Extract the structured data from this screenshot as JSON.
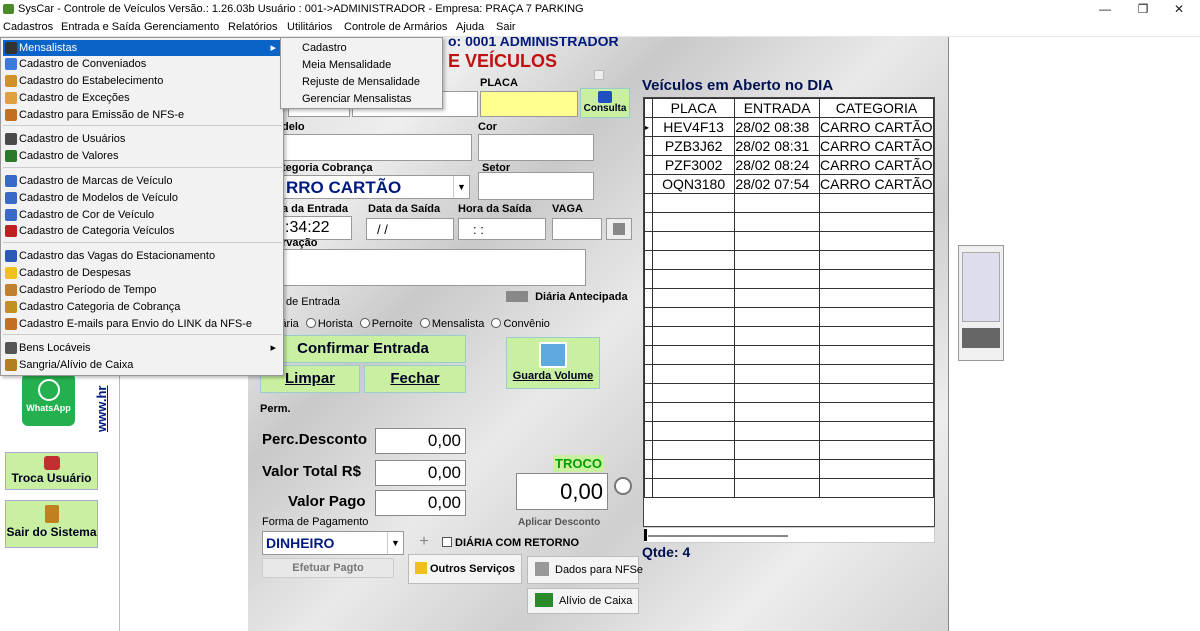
{
  "window": {
    "title": "SysCar - Controle de Veículos Versão.: 1.26.03b    Usuário : 001->ADMINISTRADOR - Empresa: PRAÇA 7 PARKING",
    "controls": {
      "minimize": "—",
      "maximize": "❐",
      "close": "✕"
    }
  },
  "menubar": [
    "Cadastros",
    "Entrada e Saída",
    "Gerenciamento",
    "Relatórios",
    "Utilitários",
    "Controle de Armários",
    "Ajuda",
    "Sair"
  ],
  "dropdown": {
    "items": [
      {
        "label": "Mensalistas",
        "accel": "M",
        "submenu": true,
        "icon": "card-icon",
        "color": "#333333"
      },
      {
        "label": "Cadastro de Conveniados",
        "accel": "C",
        "icon": "book-icon",
        "color": "#3a7ad8"
      },
      {
        "label": "Cadastro do Estabelecimento",
        "accel": "E",
        "icon": "building-icon",
        "color": "#d0902a"
      },
      {
        "label": "Cadastro de Exceções",
        "accel": "x",
        "icon": "pencil-icon",
        "color": "#e0a040"
      },
      {
        "label": "Cadastro para Emissão de NFS-e",
        "icon": "document-icon",
        "color": "#c07020"
      },
      {
        "label": "Cadastro de Usuários",
        "accel": "U",
        "icon": "users-icon",
        "color": "#4a4a4a"
      },
      {
        "label": "Cadastro de Valores",
        "accel": "V",
        "icon": "money-icon",
        "color": "#2a7a2a"
      },
      {
        "label": "Cadastro de Marcas de Veículo",
        "icon": "car-icon",
        "color": "#3a6ac8"
      },
      {
        "label": "Cadastro de Modelos de Veículo",
        "icon": "car-icon",
        "color": "#3a6ac8"
      },
      {
        "label": "Cadastro de Cor de Veículo",
        "icon": "car-icon",
        "color": "#3a6ac8"
      },
      {
        "label": "Cadastro de Categoria Veículos",
        "accel": "t",
        "icon": "car-red-icon",
        "color": "#c02020"
      },
      {
        "label": "Cadastro das Vagas do Estacionamento",
        "icon": "parking-icon",
        "color": "#2a5ab8"
      },
      {
        "label": "Cadastro de Despesas",
        "icon": "plus-icon",
        "color": "#f0c020"
      },
      {
        "label": "Cadastro Período de Tempo",
        "icon": "clock-icon",
        "color": "#c08030"
      },
      {
        "label": "Cadastro Categoria de Cobrança",
        "icon": "tools-icon",
        "color": "#c09020"
      },
      {
        "label": "Cadastro E-mails para Envio do LINK da NFS-e",
        "icon": "email-icon",
        "color": "#c07020"
      },
      {
        "label": "Bens Locáveis",
        "submenu": true,
        "icon": "tools2-icon",
        "color": "#555555"
      },
      {
        "label": "Sangria/Alívio de Caixa",
        "icon": "cash-icon",
        "color": "#b08020"
      }
    ],
    "submenu_arrow": "▸"
  },
  "submenu": [
    "Cadastro",
    "Meia Mensalidade",
    "Rejuste de Mensalidade",
    "Gerenciar Mensalistas"
  ],
  "sidebar": {
    "whatsapp": "WhatsApp",
    "link": "www.hr",
    "troca": "Troca Usuário",
    "sair": "Sair do Sistema"
  },
  "form": {
    "header_user": "o: 0001 ADMINISTRADOR",
    "header_title": "E VEÍCULOS",
    "placa": "PLACA",
    "consulta": "Consulta",
    "modelo": "delo",
    "cor": "Cor",
    "categoria_label": "tegoria Cobrança",
    "categoria_value": "RRO CARTÃO",
    "setor": "Setor",
    "hora_entrada": "a da Entrada",
    "data_saida": "Data da Saída",
    "hora_saida": "Hora da Saída",
    "vaga": "VAGA",
    "hora_value": ":34:22",
    "data_saida_value": " / /",
    "hora_saida_value": " :  :",
    "observacao": "rvação",
    "diaria_antecipada": "Diária Antecipada",
    "tipo_entrada": "de Entrada",
    "radios": [
      "iária",
      "Horista",
      "Pernoite",
      "Mensalista",
      "Convênio"
    ],
    "confirmar": "Confirmar Entrada",
    "limpar": "Limpar",
    "fechar": "Fechar",
    "guarda": "Guarda Volume",
    "perm": "Perm.",
    "perc_label": "Perc.Desconto",
    "perc_value": "0,00",
    "total_label": "Valor Total R$",
    "total_value": "0,00",
    "pago_label": "Valor Pago",
    "pago_value": "0,00",
    "troco_label": "TROCO",
    "troco_value": "0,00",
    "aplicar": "Aplicar Desconto",
    "forma_label": "Forma de Pagamento",
    "forma_value": "DINHEIRO",
    "plus": "+",
    "diaria_retorno": "DIÁRIA COM RETORNO",
    "efetuar": "Efetuar Pagto",
    "outros": "Outros Serviços",
    "dados_nfse": "Dados para NFSe",
    "alivio": "Alívio de Caixa"
  },
  "grid": {
    "title": "Veículos em Aberto no DIA",
    "headers": [
      "PLACA",
      "ENTRADA",
      "CATEGORIA"
    ],
    "rows": [
      [
        "HEV4F13",
        "28/02 08:38",
        "CARRO CARTÃO"
      ],
      [
        "PZB3J62",
        "28/02 08:31",
        "CARRO CARTÃO"
      ],
      [
        "PZF3002",
        "28/02 08:24",
        "CARRO CARTÃO"
      ],
      [
        "OQN3180",
        "28/02 07:54",
        "CARRO CARTÃO"
      ]
    ],
    "qtde": "Qtde: 4",
    "row_marker": "▸"
  },
  "colors": {
    "accent": "#0a64c8",
    "button": "#c8f0a0",
    "title_red": "#c01010",
    "navy": "#001a80",
    "troco": "#00a000",
    "placa_field": "#ffff90"
  }
}
